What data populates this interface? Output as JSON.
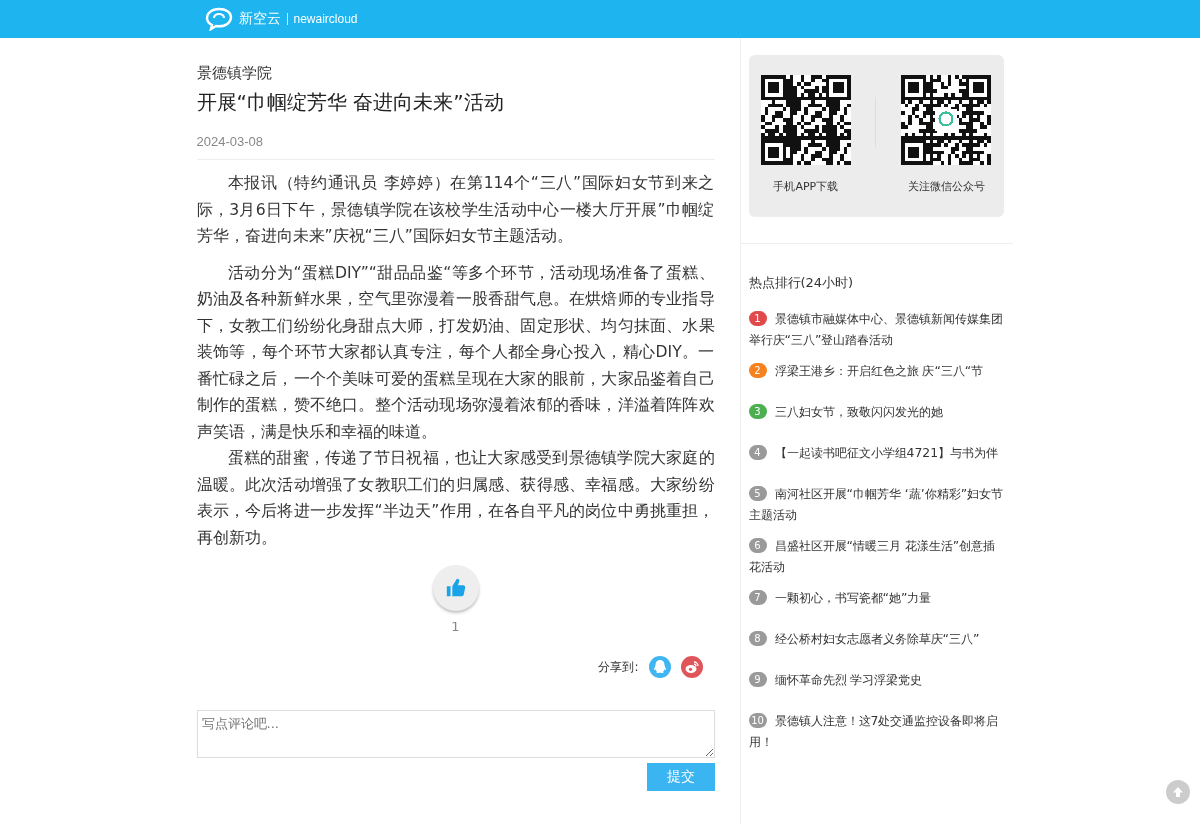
{
  "header": {
    "brand": "新空云",
    "brand_en": "newaircloud"
  },
  "article": {
    "source": "景德镇学院",
    "title": "开展“巾帼绽芳华 奋进向未来”活动",
    "date": "2024-03-08",
    "paragraphs": [
      "本报讯（特约通讯员 李婷婷）在第114个“三八”国际妇女节到来之际，3月6日下午，景德镇学院在该校学生活动中心一楼大厅开展”巾帼绽芳华，奋进向未来”庆祝“三八”国际妇女节主题活动。",
      "活动分为“蛋糕DIY”“甜品品鉴“等多个环节，活动现场准备了蛋糕、奶油及各种新鲜水果，空气里弥漫着一股香甜气息。在烘焙师的专业指导下，女教工们纷纷化身甜点大师，打发奶油、固定形状、均匀抹面、水果装饰等，每个环节大家都认真专注，每个人都全身心投入，精心DIY。一番忙碌之后，一个个美味可爱的蛋糕呈现在大家的眼前，大家品鉴着自己制作的蛋糕，赞不绝口。整个活动现场弥漫着浓郁的香味，洋溢着阵阵欢声笑语，满是快乐和幸福的味道。",
      "蛋糕的甜蜜，传递了节日祝福，也让大家感受到景德镇学院大家庭的温暖。此次活动增强了女教职工们的归属感、获得感、幸福感。大家纷纷表示，今后将进一步发挥“半边天”作用，在各自平凡的岗位中勇挑重担，再创新功。"
    ],
    "likes": "1",
    "share_label": "分享到:"
  },
  "comment": {
    "placeholder": "写点评论吧...",
    "submit": "提交"
  },
  "sidebar": {
    "qr_codes": [
      {
        "caption": "手机APP下载"
      },
      {
        "caption": "关注微信公众号"
      }
    ],
    "ranking_title": "热点排行(24小时)",
    "ranking": [
      {
        "rank": "1",
        "title": "景德镇市融媒体中心、景德镇新闻传媒集团举行庆“三八”登山踏春活动",
        "color": "#e04a4a"
      },
      {
        "rank": "2",
        "title": "浮梁王港乡：开启红色之旅 庆“三八“节",
        "color": "#f5821f"
      },
      {
        "rank": "3",
        "title": "三八妇女节，致敬闪闪发光的她",
        "color": "#4caf50"
      },
      {
        "rank": "4",
        "title": "【一起读书吧征文小学组4721】与书为伴",
        "color": "#9a9a9a"
      },
      {
        "rank": "5",
        "title": "南河社区开展“巾帼芳华 ‘蔬’你精彩”妇女节主题活动",
        "color": "#9a9a9a"
      },
      {
        "rank": "6",
        "title": "昌盛社区开展“情暖三月 花漾生活”创意插花活动",
        "color": "#9a9a9a"
      },
      {
        "rank": "7",
        "title": "一颗初心，书写瓷都“她”力量",
        "color": "#9a9a9a"
      },
      {
        "rank": "8",
        "title": "经公桥村妇女志愿者义务除草庆“三八”",
        "color": "#9a9a9a"
      },
      {
        "rank": "9",
        "title": "缅怀革命先烈 学习浮梁党史",
        "color": "#9a9a9a"
      },
      {
        "rank": "10",
        "title": "景德镇人注意！这7处交通监控设备即将启用！",
        "color": "#9a9a9a"
      }
    ]
  }
}
